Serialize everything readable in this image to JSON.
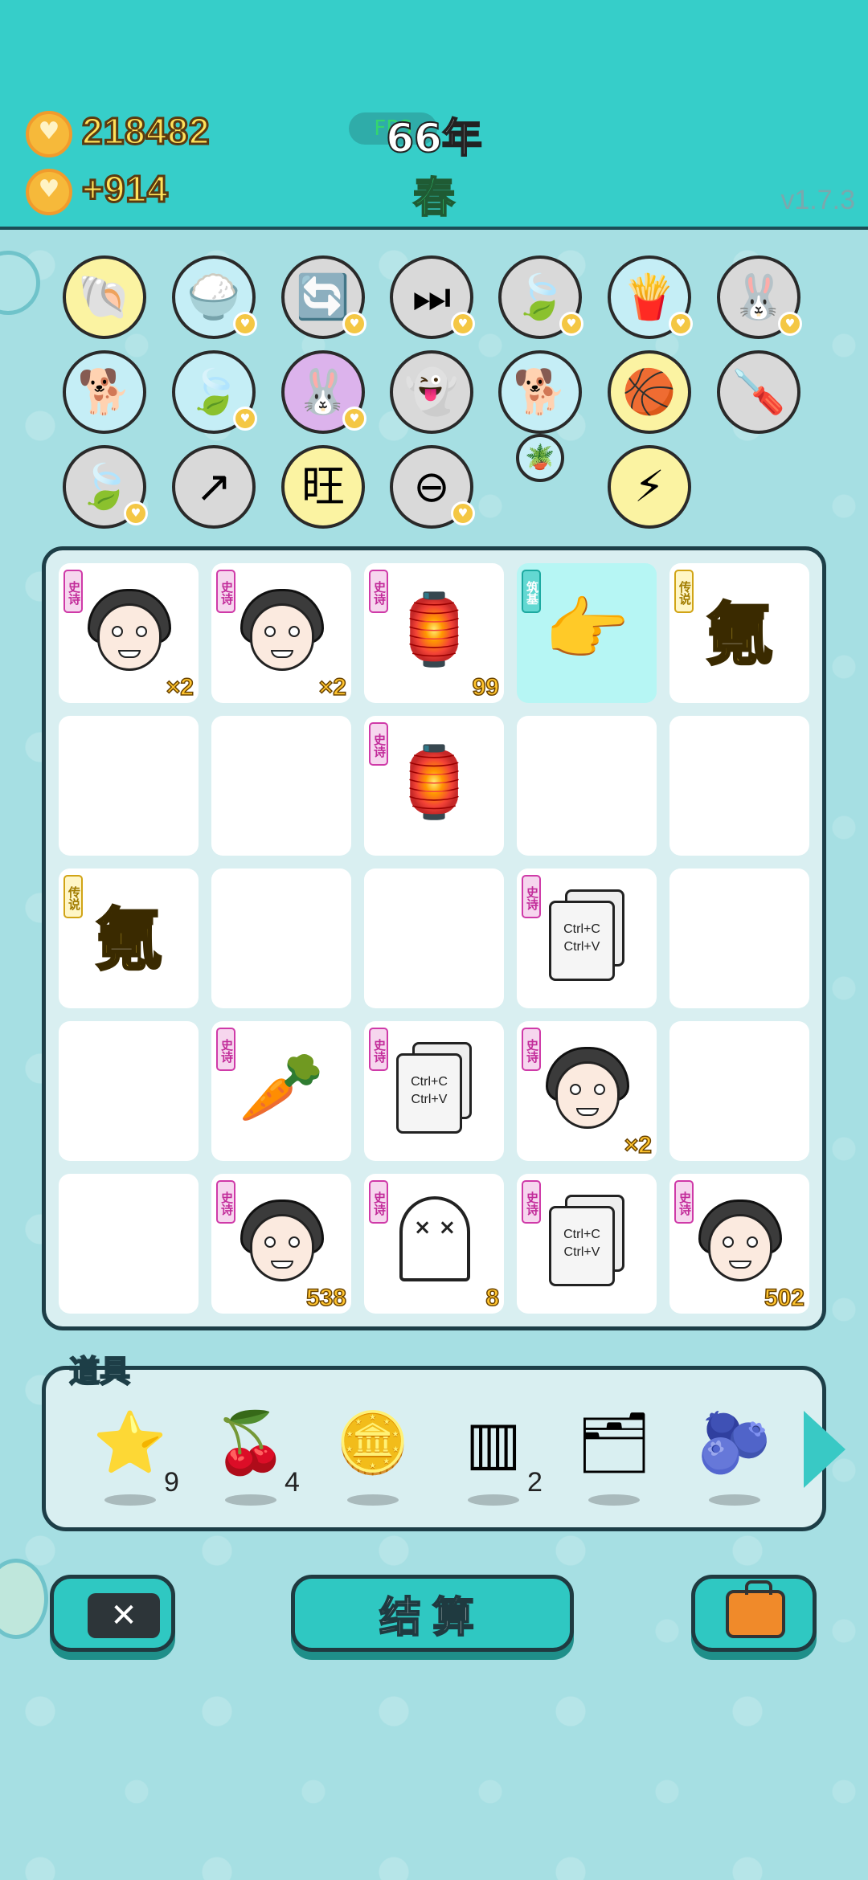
{
  "header": {
    "coins": "218482",
    "coin_delta": "+914",
    "fps_label": "FPS",
    "year": "66年",
    "season": "春",
    "version": "v1.7.3"
  },
  "inventory_rows": [
    [
      {
        "icon": "shell-icon",
        "glyph": "🐚",
        "bg": "#fbf3a2",
        "heart": false
      },
      {
        "icon": "rice-bowl-icon",
        "glyph": "🍚",
        "bg": "#c5eef6",
        "heart": true
      },
      {
        "icon": "recycle-icon",
        "glyph": "🔄",
        "bg": "#d9d9d9",
        "heart": true
      },
      {
        "icon": "skip-icon",
        "glyph": "⏭",
        "bg": "#d9d9d9",
        "heart": true
      },
      {
        "icon": "leaf-icon",
        "glyph": "🍃",
        "bg": "#d9d9d9",
        "heart": true
      },
      {
        "icon": "fries-icon",
        "glyph": "🍟",
        "bg": "#c5eef6",
        "heart": true
      },
      {
        "icon": "rabbit-icon",
        "glyph": "🐰",
        "bg": "#d9d9d9",
        "heart": true
      }
    ],
    [
      {
        "icon": "dog-sunglasses-icon",
        "glyph": "🐕",
        "bg": "#c5eef6",
        "heart": false
      },
      {
        "icon": "leaf-icon",
        "glyph": "🍃",
        "bg": "#c5eef6",
        "heart": true
      },
      {
        "icon": "rabbit-icon",
        "glyph": "🐰",
        "bg": "#dcb3ec",
        "heart": true
      },
      {
        "icon": "ghost-icon",
        "glyph": "👻",
        "bg": "#d9d9d9",
        "heart": false
      },
      {
        "icon": "dog-sunglasses-icon",
        "glyph": "🐕",
        "bg": "#c5eef6",
        "heart": false
      },
      {
        "icon": "basketballs-icon",
        "glyph": "🏀",
        "bg": "#fbf3a2",
        "heart": false
      },
      {
        "icon": "screwdriver-icon",
        "glyph": "🪛",
        "bg": "#d9d9d9",
        "heart": false
      }
    ],
    [
      {
        "icon": "leaf-icon",
        "glyph": "🍃",
        "bg": "#d9d9d9",
        "heart": true
      },
      {
        "icon": "arrow-box-icon",
        "glyph": "↗",
        "bg": "#d9d9d9",
        "heart": false
      },
      {
        "icon": "wang-tiles-icon",
        "glyph": "旺",
        "bg": "#fbf3a2",
        "heart": false
      },
      {
        "icon": "minus-circle-icon",
        "glyph": "⊖",
        "bg": "#d9d9d9",
        "heart": true
      },
      {
        "icon": "potted-plant-icon",
        "glyph": "🪴",
        "bg": "#c5eef6",
        "heart": false,
        "small": true
      },
      {
        "icon": "lightning-icon",
        "glyph": "⚡",
        "bg": "#fbf3a2",
        "heart": false
      }
    ]
  ],
  "board": [
    [
      {
        "type": "face",
        "tag": "史诗",
        "tag_kind": "epic",
        "count": "×2"
      },
      {
        "type": "face",
        "tag": "史诗",
        "tag_kind": "epic",
        "count": "×2"
      },
      {
        "type": "glyph",
        "icon": "rabbit-house-icon",
        "glyph": "🏮",
        "tag": "史诗",
        "tag_kind": "epic",
        "count": "99"
      },
      {
        "type": "glyph",
        "icon": "pointing-hand-icon",
        "glyph": "👉",
        "tag": "筑基",
        "tag_kind": "foundation",
        "count": "",
        "highlight": true
      },
      {
        "type": "char",
        "char": "氪",
        "tag": "传说",
        "tag_kind": "legend",
        "count": ""
      }
    ],
    [
      {
        "type": "empty"
      },
      {
        "type": "empty"
      },
      {
        "type": "glyph",
        "icon": "rabbit-house-icon",
        "glyph": "🏮",
        "tag": "史诗",
        "tag_kind": "epic",
        "count": ""
      },
      {
        "type": "empty"
      },
      {
        "type": "empty"
      }
    ],
    [
      {
        "type": "char",
        "char": "氪",
        "tag": "传说",
        "tag_kind": "legend",
        "count": ""
      },
      {
        "type": "empty"
      },
      {
        "type": "empty"
      },
      {
        "type": "cards",
        "line1": "Ctrl+C",
        "line2": "Ctrl+V",
        "tag": "史诗",
        "tag_kind": "epic",
        "count": ""
      },
      {
        "type": "empty"
      }
    ],
    [
      {
        "type": "empty"
      },
      {
        "type": "glyph",
        "icon": "carrot-icon",
        "glyph": "🥕",
        "tag": "史诗",
        "tag_kind": "epic",
        "count": ""
      },
      {
        "type": "cards",
        "line1": "Ctrl+C",
        "line2": "Ctrl+V",
        "tag": "史诗",
        "tag_kind": "epic",
        "count": ""
      },
      {
        "type": "face",
        "tag": "史诗",
        "tag_kind": "epic",
        "count": "×2"
      },
      {
        "type": "empty"
      }
    ],
    [
      {
        "type": "empty"
      },
      {
        "type": "face",
        "tag": "史诗",
        "tag_kind": "epic",
        "count": "538"
      },
      {
        "type": "ghost",
        "face": "× ×",
        "tag": "史诗",
        "tag_kind": "epic",
        "count": "8"
      },
      {
        "type": "cards",
        "line1": "Ctrl+C",
        "line2": "Ctrl+V",
        "tag": "史诗",
        "tag_kind": "epic",
        "count": ""
      },
      {
        "type": "face",
        "tag": "史诗",
        "tag_kind": "epic",
        "count": "502"
      }
    ]
  ],
  "items": {
    "label": "道具",
    "list": [
      {
        "icon": "star-icon",
        "glyph": "⭐",
        "count": "9"
      },
      {
        "icon": "lychee-icon",
        "glyph": "🍒",
        "count": "4"
      },
      {
        "icon": "dollar-coin-icon",
        "glyph": "🪙",
        "count": ""
      },
      {
        "icon": "triple-bars-icon",
        "glyph": "▥",
        "count": "2"
      },
      {
        "icon": "copy-card-icon",
        "glyph": "🗂",
        "count": ""
      },
      {
        "icon": "blueberry-icon",
        "glyph": "🫐",
        "count": ""
      }
    ]
  },
  "buttons": {
    "close": "✕",
    "settle": "结算"
  }
}
